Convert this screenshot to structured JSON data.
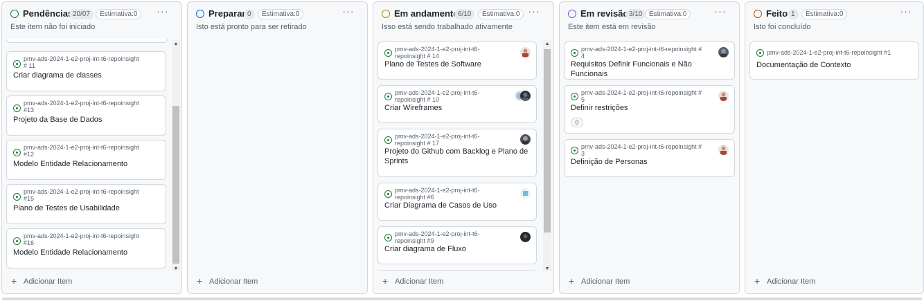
{
  "columns": [
    {
      "title": "Pendências",
      "count": "20/07",
      "estimate": "Estimativa:0",
      "description": "Este item não foi iniciado",
      "dot_color": "#1a7f37",
      "add_label": "Adicionar Item",
      "cards": [
        {
          "repo": "pmv-ads-2024-1-e2-proj-int-t6-repoinsight # 11",
          "title": "Criar diagrama de classes"
        },
        {
          "repo": "pmv-ads-2024-1-e2-proj-int-t6-repoinsight #13",
          "title": "Projeto da Base de Dados"
        },
        {
          "repo": "pmv-ads-2024-1-e2-proj-int-t6-repoinsight #12",
          "title": "Modelo Entidade Relacionamento"
        },
        {
          "repo": "pmv-ads-2024-1-e2-proj-int-t6-repoinsight #15",
          "title": "Plano de Testes de Usabilidade"
        },
        {
          "repo": "pmv-ads-2024-1-e2-proj-int-t6-repoinsight #16",
          "title": "Modelo Entidade Relacionamento"
        }
      ]
    },
    {
      "title": "Preparar",
      "count": "0",
      "estimate": "Estimativa:0",
      "description": "Isto está pronto para ser retirado",
      "dot_color": "#0969da",
      "add_label": "Adicionar Item",
      "cards": []
    },
    {
      "title": "Em andamento",
      "count": "6/10",
      "estimate": "Estimativa:0",
      "description": "Isso está sendo trabalhado ativamente",
      "dot_color": "#bf8700",
      "add_label": "Adicionar Item",
      "cards": [
        {
          "repo": "pmv-ads-2024-1-e2-proj-int-t6-repoinsight # 14",
          "title": "Plano de Testes de Software"
        },
        {
          "repo": "pmv-ads-2024-1-e2-proj-int-t6-repoinsight # 10",
          "title": "Criar Wireframes"
        },
        {
          "repo": "pmv-ads-2024-1-e2-proj-int-t6-repoinsight # 17",
          "title": "Projeto do Github com Backlog e Plano de Sprints"
        },
        {
          "repo": "pmv-ads-2024-1-e2-proj-int-t6-repoinsight #6",
          "title": "Criar Diagrama de Casos de Uso"
        },
        {
          "repo": "pmv-ads-2024-1-e2-proj-int-t6-repoinsight #9",
          "title": "Criar diagrama de Fluxo"
        }
      ]
    },
    {
      "title": "Em revisão",
      "count": "3/10",
      "estimate": "Estimativa:0",
      "description": "Este item está em revisão",
      "dot_color": "#8250df",
      "add_label": "Adicionar Item",
      "cards": [
        {
          "repo": "pmv-ads-2024-1-e2-proj-int-t6-repoinsight # 4",
          "title": "Requisitos Definir Funcionais e Não Funcionais"
        },
        {
          "repo": "pmv-ads-2024-1-e2-proj-int-t6-repoinsight # 5",
          "title": "Definir restrições",
          "sub_count": "0"
        },
        {
          "repo": "pmv-ads-2024-1-e2-proj-int-t6-repoinsight # 3",
          "title": "Definição de Personas"
        }
      ]
    },
    {
      "title": "Feito",
      "count": "1",
      "estimate": "Estimativa:0",
      "description": "Isto foi concluído",
      "dot_color": "#bc4c00",
      "add_label": "Adicionar Item",
      "cards": [
        {
          "repo": "pmv-ads-2024-1-e2-proj-int-t6-repoinsight #1",
          "title": "Documentação de Contexto"
        }
      ]
    }
  ]
}
